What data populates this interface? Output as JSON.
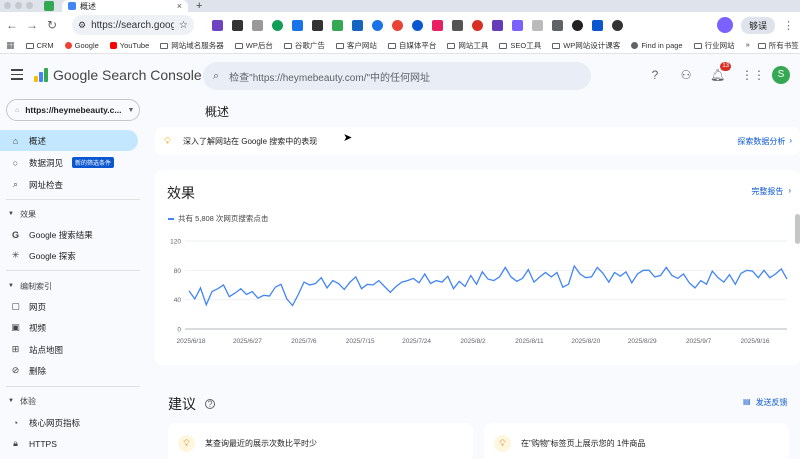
{
  "browser": {
    "tab_title": "概述",
    "new_tab": "+",
    "url": "https://search.googl...",
    "relaunch_label": "够误",
    "bookmarks": [
      "CRM",
      "Google",
      "YouTube",
      "网站域名服务器",
      "WP后台",
      "谷歌广告",
      "客户网站",
      "自媒体平台",
      "网站工具",
      "SEO工具",
      "WP网站设计课客",
      "Find in page",
      "行业网站"
    ],
    "bookmarks_more": "»",
    "all_bookmarks": "所有书签"
  },
  "header": {
    "product_name": "Google Search Console",
    "search_placeholder": "检查\"https://heymebeauty.com/\"中的任何网址",
    "notification_count": "13",
    "user_initial": "S"
  },
  "sidebar": {
    "property": "https://heymebeauty.c...",
    "items": {
      "overview": "概述",
      "insights": "数据洞见",
      "insights_badge": "新的筛选条件",
      "url_inspection": "网址检查",
      "performance_header": "效果",
      "search_results": "Google 搜索结果",
      "discover": "Google 探索",
      "indexing_header": "编制索引",
      "pages": "网页",
      "videos": "视频",
      "sitemaps": "站点地图",
      "removals": "删除",
      "experience_header": "体验",
      "cwv": "核心网页指标",
      "https": "HTTPS"
    }
  },
  "main": {
    "page_title": "概述",
    "info_text": "深入了解网站在 Google 搜索中的表现",
    "info_link": "探索数据分析",
    "performance_title": "效果",
    "full_report": "完整报告",
    "legend_text": "共有 5,808 次网页搜索点击",
    "suggestions_title": "建议",
    "feedback": "发送反馈",
    "suggestion_1": "某查询最近的展示次数比平时少",
    "suggestion_2": "在\"购物\"标签页上展示您的 1件商品"
  },
  "chart_data": {
    "type": "line",
    "series": [
      {
        "name": "共有 5,808 次网页搜索点击",
        "color": "#4285f4",
        "values": [
          52,
          41,
          56,
          33,
          51,
          55,
          60,
          44,
          49,
          55,
          47,
          51,
          42,
          46,
          45,
          57,
          61,
          41,
          32,
          47,
          64,
          60,
          62,
          70,
          56,
          66,
          62,
          54,
          64,
          71,
          55,
          61,
          60,
          66,
          58,
          50,
          58,
          64,
          66,
          69,
          63,
          75,
          62,
          66,
          64,
          72,
          55,
          65,
          58,
          73,
          61,
          78,
          68,
          66,
          71,
          84,
          71,
          65,
          69,
          81,
          64,
          71,
          77,
          71,
          77,
          57,
          61,
          86,
          75,
          70,
          71,
          84,
          76,
          64,
          77,
          72,
          78,
          63,
          75,
          80,
          80,
          71,
          73,
          84,
          73,
          69,
          75,
          63,
          56,
          66,
          61,
          79,
          70,
          64,
          74,
          61,
          76,
          80,
          79,
          70,
          80,
          70,
          75,
          82,
          68
        ]
      }
    ],
    "x_ticks": [
      "2025/6/18",
      "2025/6/27",
      "2025/7/6",
      "2025/7/15",
      "2025/7/24",
      "2025/8/2",
      "2025/8/11",
      "2025/8/20",
      "2025/8/29",
      "2025/9/7",
      "2025/9/16"
    ],
    "y_ticks": [
      "0",
      "40",
      "80",
      "120"
    ],
    "ylim": [
      0,
      120
    ],
    "grid": true
  }
}
